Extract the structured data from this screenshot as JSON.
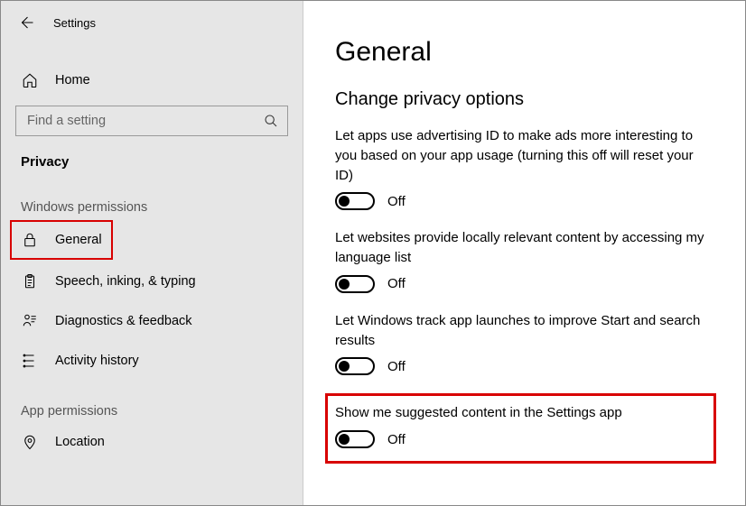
{
  "app": {
    "title": "Settings"
  },
  "sidebar": {
    "home_label": "Home",
    "search_placeholder": "Find a setting",
    "section_label": "Privacy",
    "group1_label": "Windows permissions",
    "items1": [
      {
        "label": "General"
      },
      {
        "label": "Speech, inking, & typing"
      },
      {
        "label": "Diagnostics & feedback"
      },
      {
        "label": "Activity history"
      }
    ],
    "group2_label": "App permissions",
    "items2": [
      {
        "label": "Location"
      }
    ]
  },
  "page": {
    "title": "General",
    "subhead": "Change privacy options",
    "settings": [
      {
        "desc": "Let apps use advertising ID to make ads more interesting to you based on your app usage (turning this off will reset your ID)",
        "state": "Off"
      },
      {
        "desc": "Let websites provide locally relevant content by accessing my language list",
        "state": "Off"
      },
      {
        "desc": "Let Windows track app launches to improve Start and search results",
        "state": "Off"
      },
      {
        "desc": "Show me suggested content in the Settings app",
        "state": "Off"
      }
    ]
  }
}
